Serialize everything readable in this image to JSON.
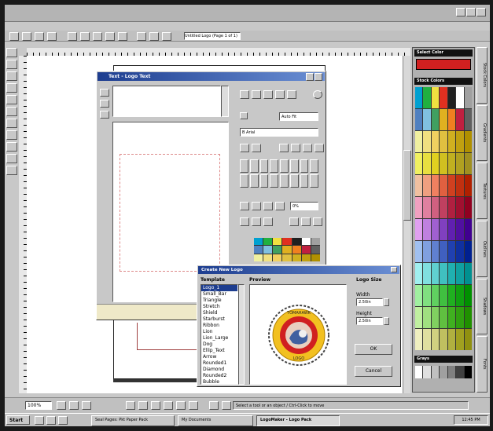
{
  "app": {
    "title_bar_text": "",
    "doc_selector_value": "Untitled Logo (Page 1 of 1)"
  },
  "colors": {
    "desktop_frame": "#1a1a1a",
    "window_bg": "#c8c8c8",
    "title_blue": "#1d3d8f",
    "accent_red": "#d02020",
    "seal_yellow": "#f2c020"
  },
  "palette_panel": {
    "select_color_label": "Select Color",
    "stock_colors_label": "Stock Colors",
    "color_rows": [
      [
        "#00a0d0",
        "#20b040",
        "#f0e040",
        "#e03020",
        "#202020",
        "#ffffff",
        "#a0a0a0"
      ],
      [
        "#5080c0",
        "#80c0e0",
        "#40a060",
        "#e0b020",
        "#f08020",
        "#c02040",
        "#606060"
      ],
      [
        "#f0f0a0",
        "#f0e080",
        "#f0d060",
        "#e0c040",
        "#d0b020",
        "#c0a010",
        "#b09000"
      ],
      [
        "#f0f060",
        "#e8e040",
        "#e0d020",
        "#d0c020",
        "#c0b020",
        "#b0a020",
        "#a09020"
      ],
      [
        "#f0c0a0",
        "#f0a080",
        "#f08060",
        "#e06040",
        "#d04020",
        "#c03010",
        "#b02000"
      ],
      [
        "#f0a0c0",
        "#e080a0",
        "#d06080",
        "#c04060",
        "#b02040",
        "#a01030",
        "#900020"
      ],
      [
        "#e0a0f0",
        "#c080e0",
        "#a060d0",
        "#8040c0",
        "#6020b0",
        "#5010a0",
        "#400090"
      ],
      [
        "#a0c0f0",
        "#80a0e0",
        "#6080d0",
        "#4060c0",
        "#2040b0",
        "#1030a0",
        "#002090"
      ],
      [
        "#a0f0f0",
        "#80e0e0",
        "#60d0d0",
        "#40c0c0",
        "#20b0b0",
        "#10a0a0",
        "#009090"
      ],
      [
        "#a0f0a0",
        "#80e080",
        "#60d060",
        "#40c040",
        "#20b020",
        "#10a010",
        "#009000"
      ],
      [
        "#c0f0a0",
        "#a0e080",
        "#80d060",
        "#60c040",
        "#40b020",
        "#30a010",
        "#209000"
      ],
      [
        "#f0f0c0",
        "#e0e0a0",
        "#d0d080",
        "#c0c060",
        "#b0b040",
        "#a0a020",
        "#909010"
      ]
    ],
    "grays_label": "Grays",
    "gray_row": [
      "#ffffff",
      "#e0e0e0",
      "#c0c0c0",
      "#a0a0a0",
      "#808080",
      "#404040",
      "#000000"
    ],
    "side_tabs": [
      "Stock Colors",
      "Gradients",
      "Textures",
      "Outlines",
      "Shadows",
      "Fonts"
    ]
  },
  "text_editor": {
    "title": "Text - Logo Text",
    "font_size_value": "Auto Fit",
    "font_name_value": "B Arial",
    "spacing_value": "0%"
  },
  "dialog": {
    "title": "Create New Logo",
    "templates_label": "Template",
    "templates": [
      "Logo_1",
      "Small_Bar",
      "Triangle",
      "Stretch",
      "Shield",
      "Starburst",
      "Ribbon",
      "Lion",
      "Lion_Large",
      "Dog",
      "Ellip_Text",
      "Arrow",
      "Rounded1",
      "Diamond",
      "Rounded2",
      "Bubble"
    ],
    "selected_index": 0,
    "preview_label": "Preview",
    "seal_top_text": "TOMAHAWK",
    "seal_bottom_text": "LOGO",
    "logo_size_label": "Logo Size",
    "width_label": "Width",
    "width_value": "2.50in",
    "height_label": "Height",
    "height_value": "2.50in",
    "ok_label": "OK",
    "cancel_label": "Cancel"
  },
  "status": {
    "zoom": "100%",
    "hint": "Select a tool or an object / Ctrl-Click to move"
  },
  "taskbar": {
    "start": "Start",
    "tasks": [
      "Seal Pages: Pkt Paper Pack",
      "My Documents",
      "LogoMaker - Logo Pack"
    ],
    "clock": "12:45 PM"
  }
}
